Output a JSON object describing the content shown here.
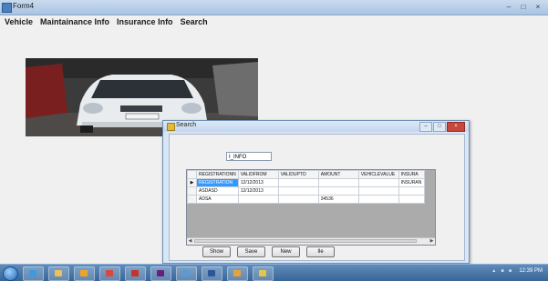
{
  "window": {
    "title": "Form4"
  },
  "menubar": {
    "items": [
      "Vehicle",
      "Maintainance Info",
      "Insurance Info",
      "Search"
    ]
  },
  "dialog": {
    "title": "Search",
    "search_value": "I_INFO",
    "columns": [
      "",
      "REGISTRATIONN",
      "VALIDFROM",
      "VALIDUPTO",
      "AMOUNT",
      "VEHICLEVALUE",
      "INSURA"
    ],
    "rows": [
      {
        "marker": "▶",
        "cells": [
          "REGISTRATION",
          "12/12/2013",
          "",
          "",
          "",
          "INSURAN"
        ]
      },
      {
        "marker": "",
        "cells": [
          "ASDASD",
          "12/12/2013",
          "",
          "",
          "",
          ""
        ]
      },
      {
        "marker": "",
        "cells": [
          "ADSA",
          "",
          "",
          "34536",
          "",
          ""
        ]
      }
    ],
    "buttons": [
      "Show",
      "Save",
      "New",
      "Ile"
    ]
  },
  "taskbar": {
    "clock": "12:39 PM",
    "icons": [
      "internet-explorer-icon",
      "explorer-folder-icon",
      "media-player-icon",
      "chrome-icon",
      "powerpoint-icon",
      "visual-studio-icon",
      "paint-icon",
      "word-icon",
      "excel-icon",
      "outlook-icon"
    ]
  },
  "colors": {
    "selected_cell": "#3399ff",
    "taskbar": "#3a6598"
  }
}
